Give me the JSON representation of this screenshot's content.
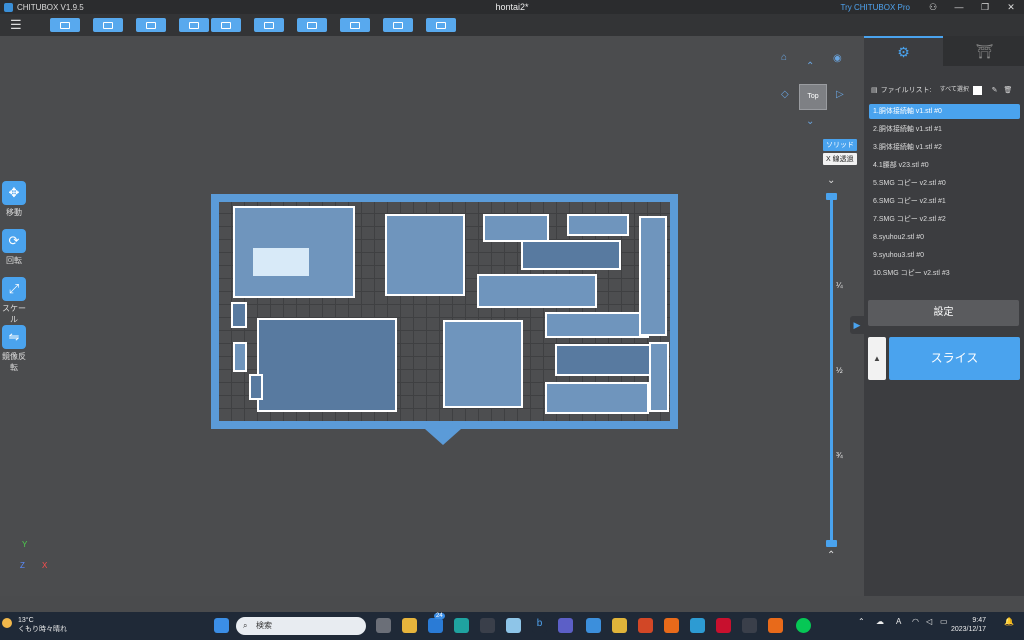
{
  "titlebar": {
    "app_name": "CHITUBOX V1.9.5",
    "document": "hontai2*",
    "promo": "Try CHITUBOX Pro",
    "buttons": [
      "user-icon",
      "minimize-icon",
      "maximize-icon",
      "close-icon"
    ]
  },
  "toolbar": {
    "menu_icon": "☰",
    "buttons": [
      "open-file-icon",
      "save-icon",
      "select-icon",
      "undo-icon",
      "redo-icon",
      "auto-layout-icon",
      "supports-icon",
      "hollow-icon",
      "print-settings-icon",
      "package-icon"
    ]
  },
  "left_tools": [
    {
      "label": "移動",
      "icon": "move-icon",
      "glyph": "✥"
    },
    {
      "label": "回転",
      "icon": "rotate-icon",
      "glyph": "⟳"
    },
    {
      "label": "スケール",
      "icon": "scale-icon",
      "glyph": "⤢"
    },
    {
      "label": "鏡像反転",
      "icon": "mirror-icon",
      "glyph": "⇋"
    }
  ],
  "view": {
    "cube_label": "Top",
    "mode_solid": "ソリッド",
    "mode_xray": "X 線透過",
    "layer_ticks": [
      "¼",
      "½",
      "¾"
    ],
    "axis": {
      "y": "Y",
      "z": "Z",
      "x": "X"
    }
  },
  "panel": {
    "file_list_label": "ファイルリスト:",
    "select_all_label": "すべて選択",
    "files": [
      "1.胴体接続軸 v1.stl #0",
      "2.胴体接続軸 v1.stl #1",
      "3.胴体接続軸 v1.stl #2",
      "4.1腰部 v23.stl #0",
      "5.SMG コピー v2.stl #0",
      "6.SMG コピー v2.stl #1",
      "7.SMG コピー v2.stl #2",
      "8.syuhou2.stl #0",
      "9.syuhou3.stl #0",
      "10.SMG コピー v2.stl #3"
    ],
    "settings_label": "設定",
    "slice_label": "スライス"
  },
  "taskbar": {
    "temperature": "13°C",
    "weather": "くもり時々晴れ",
    "search_placeholder": "検索",
    "time": "9:47",
    "date": "2023/12/17",
    "mail_badge": "24",
    "ime": "A"
  },
  "colors": {
    "accent": "#4aa3ee",
    "plate": "#5b9bd8",
    "part": "#6f95bd"
  }
}
